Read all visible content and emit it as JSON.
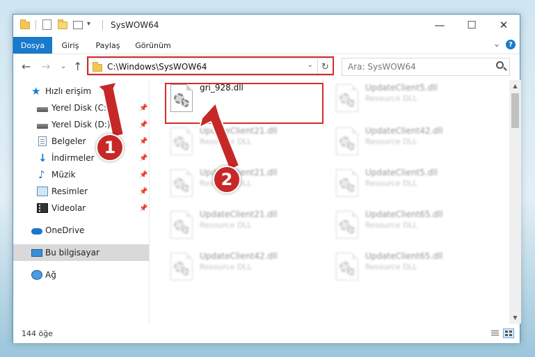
{
  "window": {
    "title": "SysWOW64",
    "controls": {
      "minimize": "—",
      "maximize": "☐",
      "close": "✕"
    }
  },
  "ribbon": {
    "tabs": [
      "Dosya",
      "Giriş",
      "Paylaş",
      "Görünüm"
    ],
    "active_tab": "Dosya",
    "collapse_chevron": "⌄",
    "help": "?"
  },
  "navigation": {
    "back": "←",
    "forward": "→",
    "recent": "⌄",
    "up": "↑",
    "address": "C:\\Windows\\SysWOW64",
    "address_dropdown": "⌄",
    "refresh": "↻",
    "search_placeholder": "Ara: SysWOW64"
  },
  "sidebar": {
    "quick_access": "Hızlı erişim",
    "items": [
      {
        "label": "Yerel Disk (C:)",
        "icon": "drive-icon",
        "pinned": true
      },
      {
        "label": "Yerel Disk (D:)",
        "icon": "drive-icon",
        "pinned": true
      },
      {
        "label": "Belgeler",
        "icon": "documents-icon",
        "pinned": true
      },
      {
        "label": "İndirmeler",
        "icon": "downloads-icon",
        "pinned": true
      },
      {
        "label": "Müzik",
        "icon": "music-icon",
        "pinned": true
      },
      {
        "label": "Resimler",
        "icon": "pictures-icon",
        "pinned": true
      },
      {
        "label": "Videolar",
        "icon": "videos-icon",
        "pinned": true
      }
    ],
    "onedrive": "OneDrive",
    "this_pc": "Bu bilgisayar",
    "network": "Ağ",
    "pin_glyph": "📌"
  },
  "files": [
    {
      "name": "gri_928.dll",
      "desc": "",
      "highlighted": true
    },
    {
      "name": "UpdateClient5.dll",
      "desc": "Resource DLL",
      "highlighted": false
    },
    {
      "name": "UpdateClient21.dll",
      "desc": "Resource DLL",
      "highlighted": false
    },
    {
      "name": "UpdateClient42.dll",
      "desc": "Resource DLL",
      "highlighted": false
    },
    {
      "name": "UpdateClient21.dll",
      "desc": "Resource DLL",
      "highlighted": false
    },
    {
      "name": "UpdateClient5.dll",
      "desc": "Resource DLL",
      "highlighted": false
    },
    {
      "name": "UpdateClient21.dll",
      "desc": "Resource DLL",
      "highlighted": false
    },
    {
      "name": "UpdateClient65.dll",
      "desc": "Resource DLL",
      "highlighted": false
    },
    {
      "name": "UpdateClient42.dll",
      "desc": "Resource DLL",
      "highlighted": false
    },
    {
      "name": "UpdateClient65.dll",
      "desc": "Resource DLL",
      "highlighted": false
    }
  ],
  "scrollbar": {
    "up": "▲",
    "down": "▼"
  },
  "status": {
    "count": "144 öğe"
  },
  "annotations": {
    "step1": "1",
    "step2": "2",
    "color": "#c62828"
  }
}
